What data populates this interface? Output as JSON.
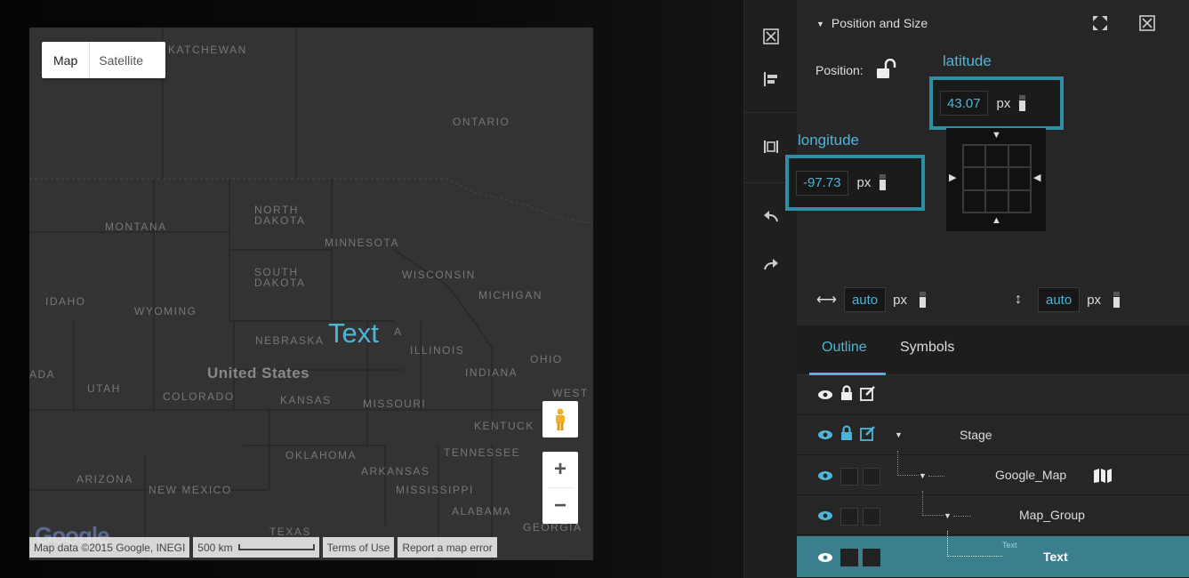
{
  "map": {
    "type_control": {
      "map_label": "Map",
      "satellite_label": "Satellite"
    },
    "labels": {
      "saskatchewan": "KATCHEWAN",
      "ontario": "ONTARIO",
      "montana": "MONTANA",
      "north_dakota": "NORTH\nDAKOTA",
      "minnesota": "MINNESOTA",
      "south_dakota": "SOUTH\nDAKOTA",
      "wisconsin": "WISCONSIN",
      "michigan": "MICHIGAN",
      "idaho": "IDAHO",
      "wyoming": "WYOMING",
      "nebraska": "NEBRASKA",
      "iowa_partial": "A",
      "illinois": "ILLINOIS",
      "ohio": "OHIO",
      "indiana": "INDIANA",
      "nevada_partial": "ADA",
      "utah": "UTAH",
      "united_states": "United States",
      "colorado": "COLORADO",
      "kansas": "KANSAS",
      "missouri": "MISSOURI",
      "west_partial": "WEST",
      "kentucky": "KENTUCK",
      "oklahoma": "OKLAHOMA",
      "tennessee": "TENNESSEE",
      "arkansas": "ARKANSAS",
      "arizona": "ARIZONA",
      "new_mexico": "NEW MEXICO",
      "mississippi": "MISSISSIPPI",
      "alabama": "ALABAMA",
      "texas": "TEXAS",
      "georgia": "GEORGIA"
    },
    "overlay_text": "Text",
    "zoom_in": "+",
    "zoom_out": "−",
    "google_logo": "Google",
    "attribution": {
      "map_data": "Map data ©2015 Google, INEGI",
      "scale": "500 km",
      "terms": "Terms of Use",
      "report": "Report a map error"
    }
  },
  "toolbar": {
    "icons": [
      "close-box-icon",
      "align-left-icon",
      "distribute-icon",
      "undo-icon",
      "redo-icon"
    ]
  },
  "panel": {
    "title": "Position and Size",
    "position_label": "Position:",
    "latitude_label": "latitude",
    "latitude_value": "43.07",
    "longitude_label": "longitude",
    "longitude_value": "-97.73",
    "unit": "px",
    "width_value": "auto",
    "height_value": "auto"
  },
  "outline": {
    "tabs": {
      "outline": "Outline",
      "symbols": "Symbols"
    },
    "rows": [
      {
        "label": ""
      },
      {
        "label": "Stage"
      },
      {
        "label": "Google_Map"
      },
      {
        "label": "Map_Group"
      },
      {
        "label": "Text",
        "ghost": "Text"
      }
    ]
  },
  "colors": {
    "accent": "#4fb5d6",
    "callout_border": "#2e8ea3",
    "selected_row": "#3b7f8e"
  }
}
